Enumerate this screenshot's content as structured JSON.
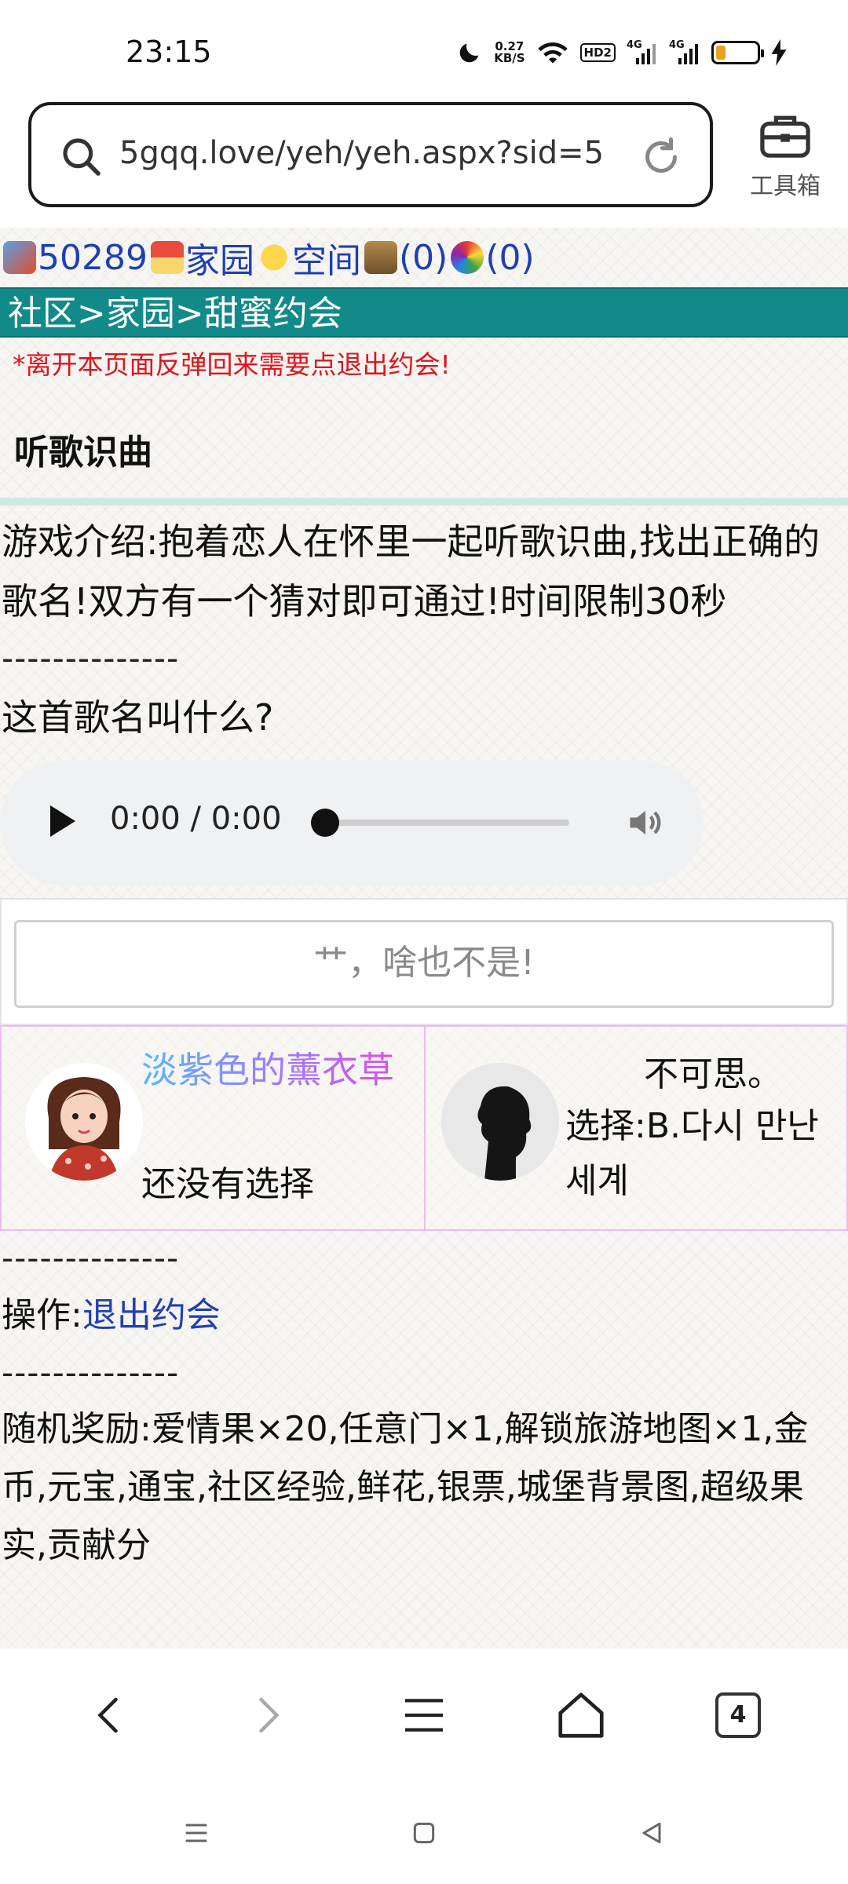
{
  "status_bar": {
    "time": "23:15",
    "speed_value": "0.27",
    "speed_unit": "KB/S",
    "hd_badge": "HD2",
    "net1": "4G",
    "net2": "4G",
    "battery_level": 0.24
  },
  "browser": {
    "url": "5gqq.love/yeh/yeh.aspx?sid=5···",
    "toolbox_label": "工具箱"
  },
  "top_links": {
    "user_id": "50289",
    "home": "家园",
    "space": "空间",
    "bank": "(0)",
    "misc": "(0)"
  },
  "breadcrumb": "社区>家园>甜蜜约会",
  "warning": "*离开本页面反弹回来需要点退出约会!",
  "game_title": "听歌识曲",
  "intro": "游戏介绍:抱着恋人在怀里一起听歌识曲,找出正确的歌名!双方有一个猜对即可通过!时间限制30秒",
  "divider": "--------------",
  "question": "这首歌名叫什么?",
  "audio": {
    "time": "0:00 / 0:00"
  },
  "answer_option": "艹，啥也不是!",
  "players": [
    {
      "name": "淡紫色的薰衣草",
      "status": "还没有选择"
    },
    {
      "name": "不可思。",
      "choice": "选择:B.다시 만난 세계"
    }
  ],
  "operation": {
    "label": "操作:",
    "exit_link": "退出约会"
  },
  "reward": "随机奖励:爱情果×20,任意门×1,解锁旅游地图×1,金币,元宝,通宝,社区经验,鲜花,银票,城堡背景图,超级果实,贡献分",
  "colors": {
    "teal_bar": "#138a8a",
    "link_blue": "#1f3fb3",
    "warning_red": "#e0141e",
    "player_border": "#f0b9f0"
  },
  "bottom_nav": {
    "tab_count": "4"
  }
}
